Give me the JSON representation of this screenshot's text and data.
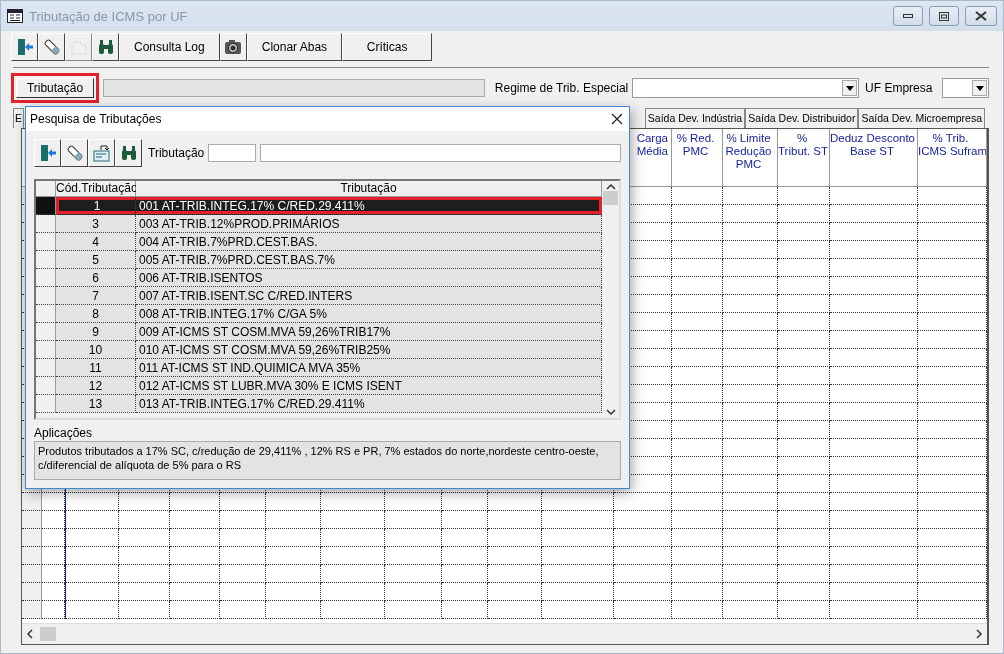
{
  "window": {
    "title": "Tributação de ICMS por UF"
  },
  "toolbar": [
    {
      "kind": "icon",
      "disabled": false
    },
    {
      "kind": "icon",
      "disabled": false
    },
    {
      "kind": "icon",
      "disabled": true
    },
    {
      "kind": "icon",
      "disabled": false
    },
    {
      "kind": "text",
      "label": "Consulta Log"
    },
    {
      "kind": "icon",
      "disabled": false
    },
    {
      "kind": "text",
      "label": "Clonar Abas"
    },
    {
      "kind": "text",
      "label": "Críticas"
    }
  ],
  "tributacao_button": {
    "label": "Tributação",
    "highlighted": true
  },
  "regime": {
    "label": "Regime de Trib. Especial"
  },
  "uf_empresa": {
    "label": "UF Empresa"
  },
  "tabs": [
    {
      "label": "E",
      "selected": false
    },
    {
      "label": "Saída Dev. Indústria",
      "selected": false
    },
    {
      "label": "Saída Dev. Distribuidor",
      "selected": false
    },
    {
      "label": "Saída Dev. Microempresa",
      "selected": false
    }
  ],
  "table": {
    "columns": [
      {
        "label": "Carga\nMédia"
      },
      {
        "label": "% Red.\nPMC"
      },
      {
        "label": "% Limite\nRedução\nPMC"
      },
      {
        "label": "%\nTribut. ST"
      },
      {
        "label": "Deduz Desconto\nBase ST"
      },
      {
        "label": "% Trib.\nICMS Sufram"
      }
    ]
  },
  "dialog": {
    "title": "Pesquisa de Tributações",
    "search_label": "Tributação",
    "columns": [
      "Cód.Tributação",
      "Tributação"
    ],
    "rows": [
      {
        "code": "1",
        "name": "001 AT-TRIB.INTEG.17% C/RED.29.411%",
        "selected": true
      },
      {
        "code": "3",
        "name": "003 AT-TRIB.12%PROD.PRIMÁRIOS",
        "selected": false
      },
      {
        "code": "4",
        "name": "004 AT-TRIB.7%PRD.CEST.BAS.",
        "selected": false
      },
      {
        "code": "5",
        "name": "005 AT-TRIB.7%PRD.CEST.BAS.7%",
        "selected": false
      },
      {
        "code": "6",
        "name": "006 AT-TRIB.ISENTOS",
        "selected": false
      },
      {
        "code": "7",
        "name": "007 AT-TRIB.ISENT.SC C/RED.INTERS",
        "selected": false
      },
      {
        "code": "8",
        "name": "008 AT-TRIB.INTEG.17% C/GA 5%",
        "selected": false
      },
      {
        "code": "9",
        "name": "009 AT-ICMS ST COSM.MVA 59,26%TRIB17%",
        "selected": false
      },
      {
        "code": "10",
        "name": "010 AT-ICMS ST COSM.MVA 59,26%TRIB25%",
        "selected": false
      },
      {
        "code": "11",
        "name": "011 AT-ICMS ST IND.QUIMICA MVA 35%",
        "selected": false
      },
      {
        "code": "12",
        "name": "012 AT-ICMS ST LUBR.MVA 30% E ICMS ISENT",
        "selected": false
      },
      {
        "code": "13",
        "name": "013 AT-TRIB.INTEG.17% C/RED.29.411%",
        "selected": false
      }
    ],
    "applications_label": "Aplicações",
    "applications_text": "Produtos tributados a 17% SC, c/redução de 29,411% , 12% RS e PR, 7% estados do norte,nordeste centro-oeste, c/diferencial de alíquota de 5% para o RS"
  }
}
